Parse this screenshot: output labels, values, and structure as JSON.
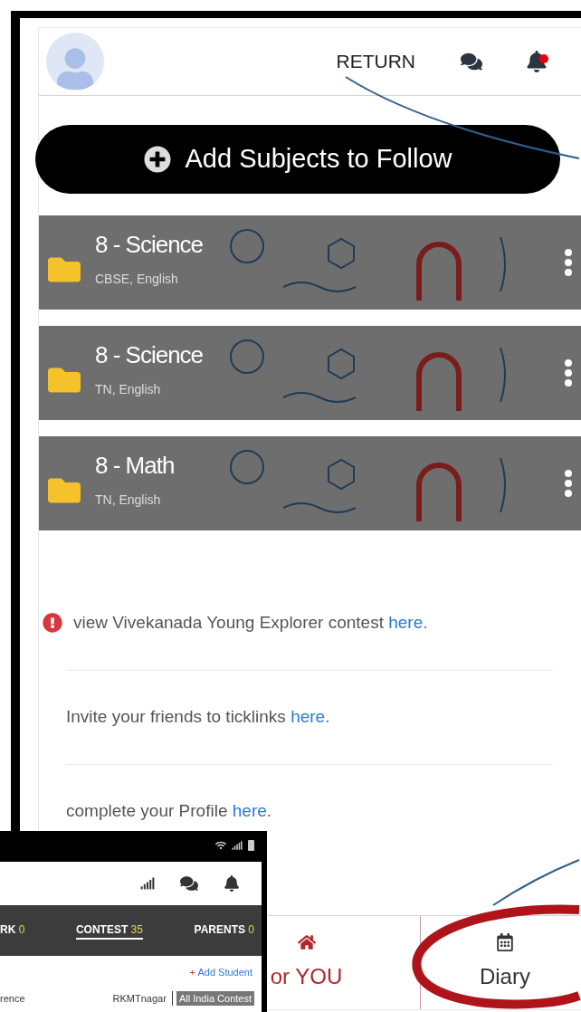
{
  "header": {
    "return_label": "RETURN",
    "notification_unread": true
  },
  "add_button": {
    "label": "Add Subjects to Follow"
  },
  "subjects": [
    {
      "title": "8 - Science",
      "subtitle": "CBSE, English"
    },
    {
      "title": "8 - Science",
      "subtitle": "TN, English"
    },
    {
      "title": "8 - Math",
      "subtitle": "TN, English"
    }
  ],
  "notices": [
    {
      "kind": "alert",
      "text": "view Vivekanada Young Explorer contest ",
      "link": "here."
    },
    {
      "kind": "plain",
      "text": "Invite your friends to ticklinks ",
      "link": "here."
    },
    {
      "kind": "plain",
      "text": "complete your Profile ",
      "link": "here."
    }
  ],
  "bottom_nav": [
    {
      "label": "or YOU",
      "kind": "home",
      "selected": true
    },
    {
      "label": "Diary",
      "kind": "calendar",
      "selected": false
    }
  ],
  "inset": {
    "tabs": [
      {
        "label": "RK",
        "count": "0",
        "selected": false
      },
      {
        "label": "CONTEST",
        "count": "35",
        "selected": true
      },
      {
        "label": "PARENTS",
        "count": "0",
        "selected": false
      }
    ],
    "add_student_mark": "+",
    "add_student": "Add Student",
    "row_left": "rence",
    "school": "RKMTnagar",
    "contest_tag": "All India Contest"
  }
}
